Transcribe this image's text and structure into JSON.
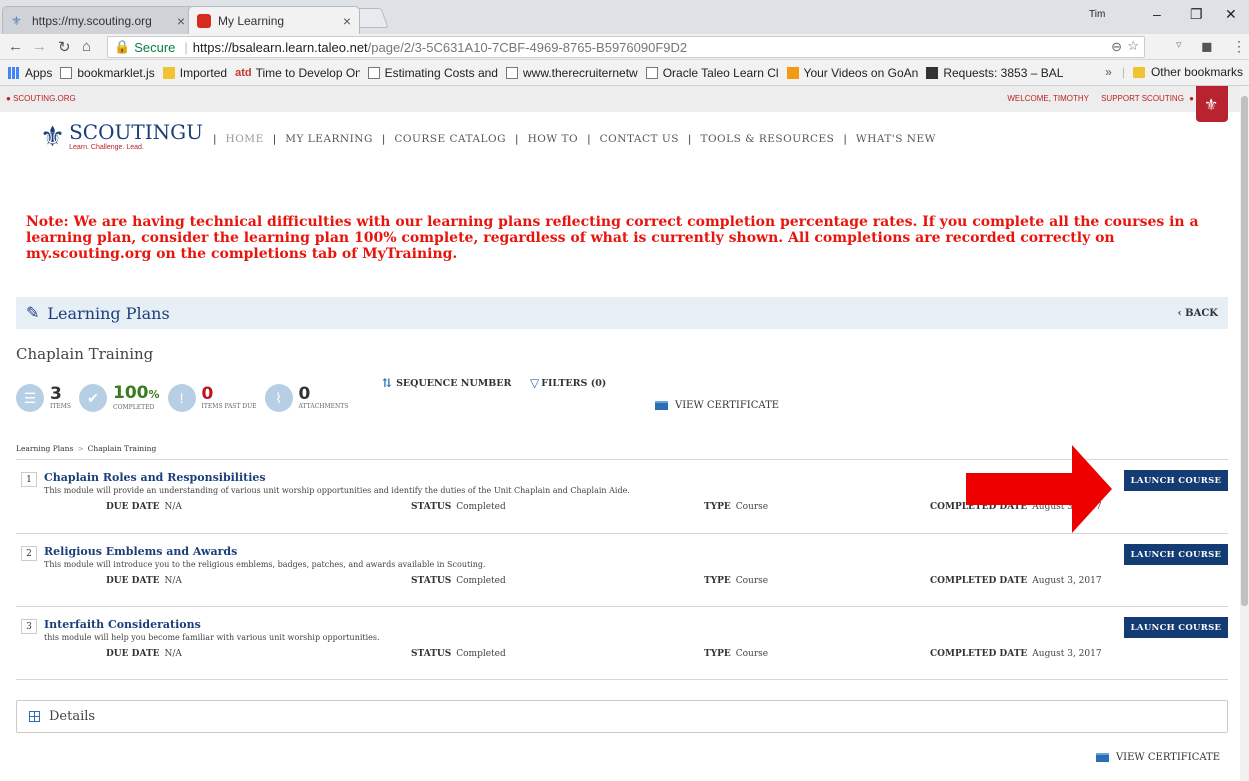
{
  "browser": {
    "tabs": [
      {
        "title": "https://my.scouting.org",
        "active": false
      },
      {
        "title": "My Learning",
        "active": true
      }
    ],
    "user": "Tim",
    "window_controls": {
      "minimize": "–",
      "restore": "❐",
      "close": "✕"
    },
    "address": {
      "secure_label": "Secure",
      "url_host": "https://bsalearn.learn.taleo.net",
      "url_path": "/page/2/3-5C631A10-7CBF-4969-8765-B5976090F9D2"
    },
    "bookmarks": [
      {
        "label": "Apps",
        "icon": "apps-icon"
      },
      {
        "label": "bookmarklet.js",
        "icon": "page-icon"
      },
      {
        "label": "Imported",
        "icon": "folder-icon"
      },
      {
        "label": "Time to Develop One",
        "icon": "atd-icon"
      },
      {
        "label": "Estimating Costs and",
        "icon": "page-icon"
      },
      {
        "label": "www.therecruiternetw",
        "icon": "page-icon"
      },
      {
        "label": "Oracle Taleo Learn Cl",
        "icon": "page-icon"
      },
      {
        "label": "Your Videos on GoAn",
        "icon": "goanimate-icon"
      },
      {
        "label": "Requests: 3853 – BAL",
        "icon": "p-icon"
      }
    ],
    "bookmarks_overflow": "»",
    "other_bookmarks": "Other bookmarks"
  },
  "site": {
    "topbar_left": "SCOUTING.ORG",
    "welcome": "WELCOME, TIMOTHY",
    "support": "SUPPORT SCOUTING",
    "logo_name": "SCOUTINGU",
    "logo_tagline": "Learn. Challenge. Lead.",
    "nav": [
      "HOME",
      "MY LEARNING",
      "COURSE CATALOG",
      "HOW TO",
      "CONTACT US",
      "TOOLS & RESOURCES",
      "WHAT'S NEW"
    ]
  },
  "note": "Note: We are having technical difficulties with our learning plans reflecting correct completion percentage rates. If you complete all the courses in a learning plan, consider the learning plan 100% complete, regardless of what is currently shown. All completions are recorded correctly on my.scouting.org on the completions tab of MyTraining.",
  "learning_plans": {
    "header": "Learning Plans",
    "back": "BACK",
    "plan_title": "Chaplain Training",
    "sequence": "SEQUENCE NUMBER",
    "filters": "FILTERS (0)",
    "view_certificate": "VIEW CERTIFICATE",
    "stats": {
      "items_value": "3",
      "items_label": "ITEMS",
      "completed_value": "100",
      "completed_unit": "%",
      "completed_label": "COMPLETED",
      "past_due_value": "0",
      "past_due_label": "ITEMS PAST DUE",
      "attachments_value": "0",
      "attachments_label": "ATTACHMENTS"
    },
    "breadcrumb": [
      "Learning Plans",
      "Chaplain Training"
    ],
    "field_labels": {
      "due": "DUE DATE",
      "status": "STATUS",
      "type": "TYPE",
      "completed": "COMPLETED DATE"
    },
    "launch_label": "LAUNCH COURSE",
    "courses": [
      {
        "num": "1",
        "name": "Chaplain Roles and Responsibilities",
        "desc": "This module will provide an understanding of various unit worship opportunities and identify the duties of the Unit Chaplain and Chaplain Aide.",
        "due": "N/A",
        "status": "Completed",
        "type": "Course",
        "completed": "August 3, 2017"
      },
      {
        "num": "2",
        "name": "Religious Emblems and Awards",
        "desc": "This module will introduce you to the religious emblems, badges, patches, and awards available in Scouting.",
        "due": "N/A",
        "status": "Completed",
        "type": "Course",
        "completed": "August 3, 2017"
      },
      {
        "num": "3",
        "name": "Interfaith Considerations",
        "desc": "this module will help you become familiar with various unit worship opportunities.",
        "due": "N/A",
        "status": "Completed",
        "type": "Course",
        "completed": "August 3, 2017"
      }
    ],
    "details": "Details"
  },
  "colors": {
    "accent_navy": "#133b74",
    "note_red": "#e8150d",
    "arrow_red": "#ee0000"
  }
}
